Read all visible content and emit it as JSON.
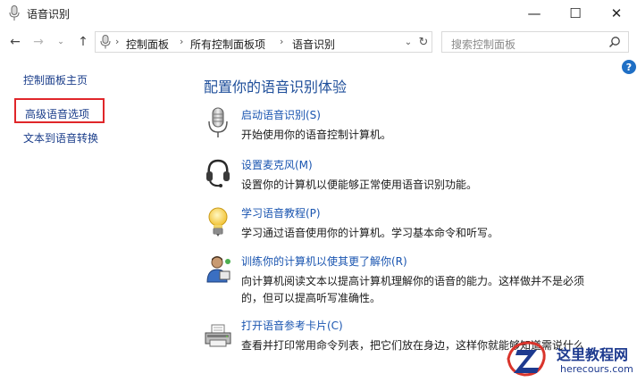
{
  "window": {
    "title": "语音识别",
    "minimize_glyph": "—",
    "maximize_glyph": "☐",
    "close_glyph": "✕"
  },
  "nav": {
    "back_glyph": "←",
    "forward_glyph": "→",
    "recent_glyph": "⌄",
    "up_glyph": "↑",
    "breadcrumbs": [
      "控制面板",
      "所有控制面板项",
      "语音识别"
    ],
    "separator": "›",
    "dropdown_glyph": "⌄",
    "refresh_glyph": "↻",
    "search_placeholder": "搜索控制面板"
  },
  "help_glyph": "?",
  "sidebar": {
    "home": "控制面板主页",
    "advanced": "高级语音选项",
    "tts": "文本到语音转换",
    "highlight_color": "#e0262a"
  },
  "main": {
    "title": "配置你的语音识别体验",
    "tasks": [
      {
        "icon": "microphone-icon",
        "link": "启动语音识别(S)",
        "desc": "开始使用你的语音控制计算机。"
      },
      {
        "icon": "headset-icon",
        "link": "设置麦克风(M)",
        "desc": "设置你的计算机以便能够正常使用语音识别功能。"
      },
      {
        "icon": "lightbulb-icon",
        "link": "学习语音教程(P)",
        "desc": "学习通过语音使用你的计算机。学习基本命令和听写。"
      },
      {
        "icon": "user-training-icon",
        "link": "训练你的计算机以使其更了解你(R)",
        "desc": "向计算机阅读文本以提高计算机理解你的语音的能力。这样做并不是必须的，但可以提高听写准确性。"
      },
      {
        "icon": "printer-icon",
        "link": "打开语音参考卡片(C)",
        "desc": "查看并打印常用命令列表，把它们放在身边，这样你就能够知道需说什么"
      }
    ]
  },
  "watermark": {
    "name": "这里教程网",
    "url": "herecours.com",
    "color": "#1d3a8f"
  }
}
